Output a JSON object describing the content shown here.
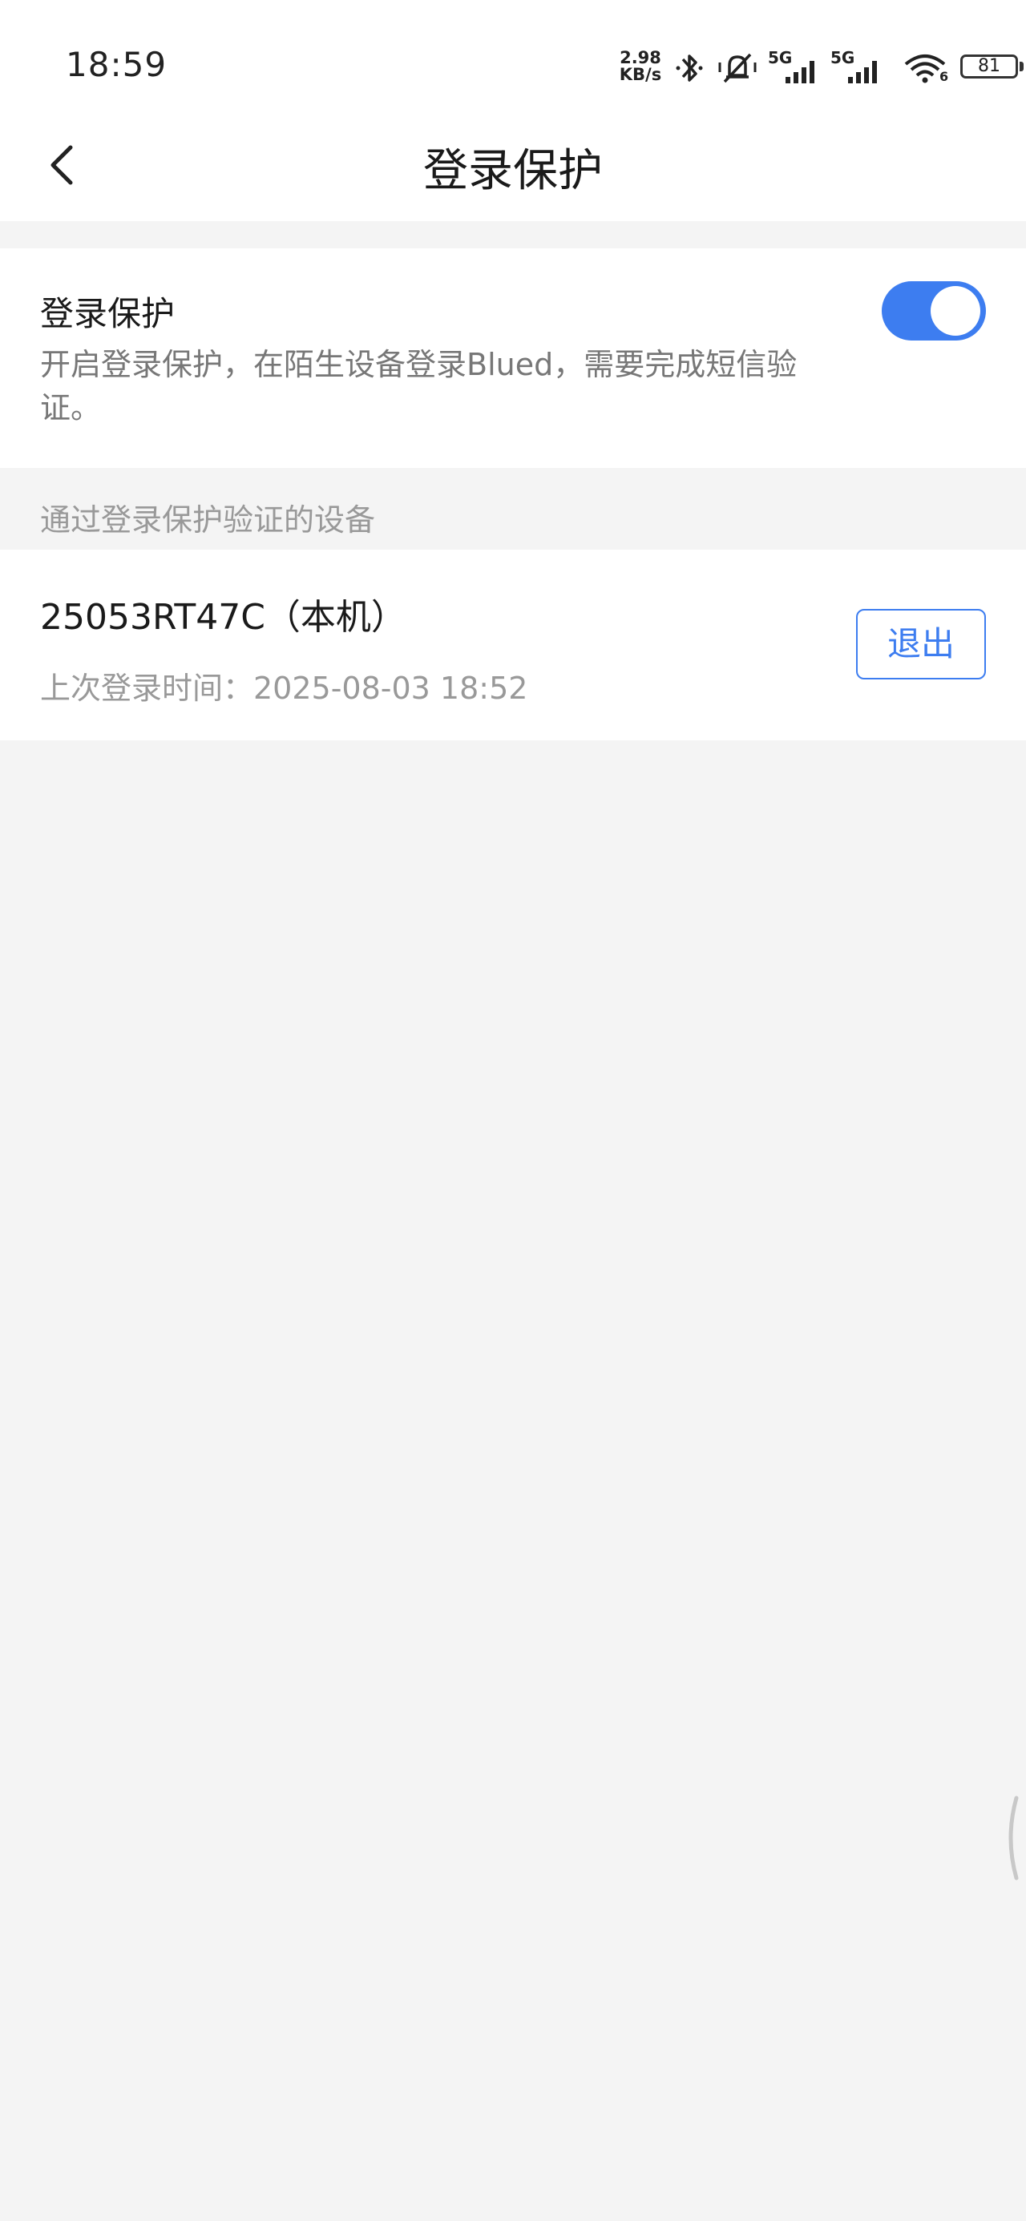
{
  "status_bar": {
    "time": "18:59",
    "net_speed_value": "2.98",
    "net_speed_unit": "KB/s",
    "network_type_1": "5G",
    "network_type_2": "5G",
    "wifi_badge": "6",
    "battery_level": "81",
    "icons": [
      "bluetooth-icon",
      "muted-bell-icon",
      "signal-icon",
      "signal-icon",
      "wifi-icon",
      "battery-icon"
    ]
  },
  "nav": {
    "title": "登录保护",
    "back_icon": "chevron-left-icon"
  },
  "login_protection": {
    "title": "登录保护",
    "description": "开启登录保护，在陌生设备登录Blued，需要完成短信验证。",
    "enabled": true,
    "accent_color": "#3d7df0"
  },
  "devices_section": {
    "header": "通过登录保护验证的设备",
    "devices": [
      {
        "name": "25053RT47C（本机）",
        "last_login": "上次登录时间：2025-08-03 18:52",
        "action_label": "退出"
      }
    ]
  },
  "colors": {
    "background": "#f4f4f4",
    "card": "#ffffff",
    "primary": "#3d7df0",
    "secondary_text": "#999999"
  }
}
